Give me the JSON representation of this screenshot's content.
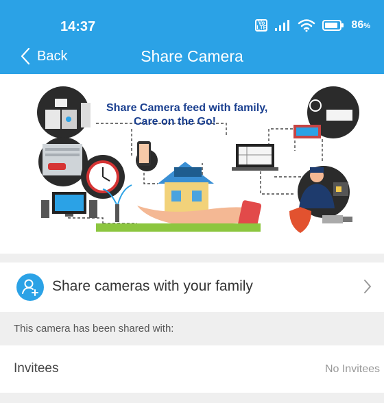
{
  "status_bar": {
    "time": "14:37",
    "volte": "Vo LTE",
    "battery_percent": "86",
    "battery_unit": "%",
    "icons": [
      "volte-icon",
      "signal-icon",
      "wifi-icon",
      "battery-icon"
    ]
  },
  "nav": {
    "back_label": "Back",
    "title": "Share Camera"
  },
  "hero": {
    "headline_1": "Share Camera feed with family,",
    "headline_2": "Care on the Go!",
    "headline_color": "#1a3f8f"
  },
  "share_row": {
    "label": "Share cameras with your family",
    "icon": "add-user-icon"
  },
  "shared_with": {
    "header": "This camera has been shared with:"
  },
  "invitees": {
    "label": "Invitees",
    "value": "No Invitees"
  },
  "colors": {
    "accent": "#2ba2e6",
    "section_bg": "#efefef"
  }
}
